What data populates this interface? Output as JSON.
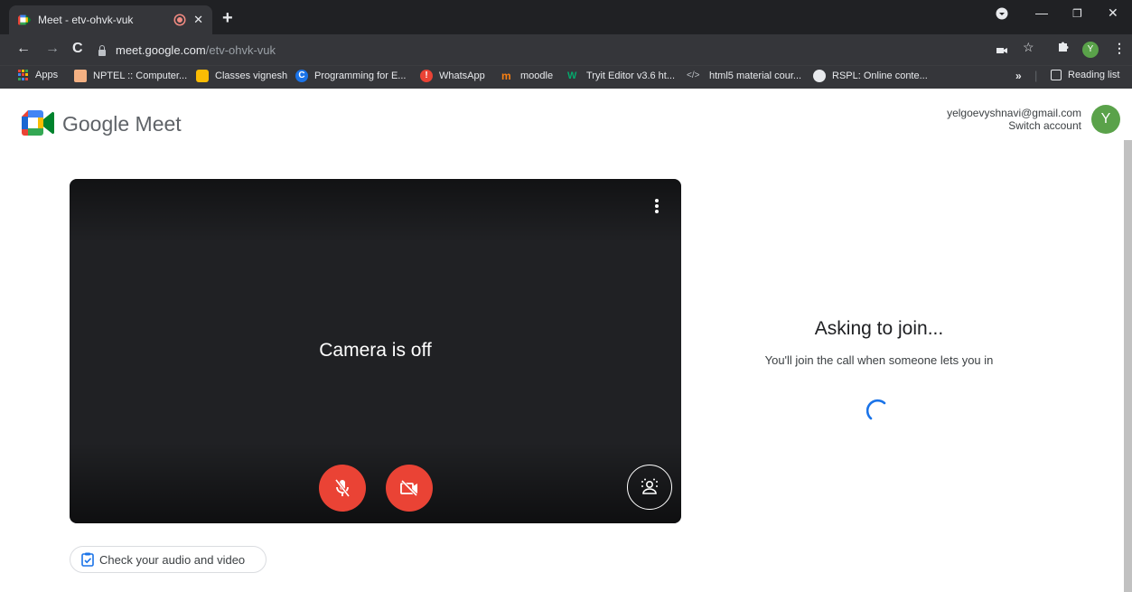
{
  "browser": {
    "tab": {
      "title": "Meet - etv-ohvk-vuk",
      "close_icon": "close-icon",
      "recording_indicator": "recording-dot-icon"
    },
    "new_tab": "+",
    "window_controls": {
      "minimize": "—",
      "restore": "❐",
      "close": "✕"
    },
    "url_host": "meet.google.com",
    "url_path": "/etv-ohvk-vuk",
    "profile_initial": "Y",
    "bookmarks": [
      {
        "label": "Apps",
        "icon": "apps-grid-icon"
      },
      {
        "label": "NPTEL :: Computer...",
        "icon": "nptel-icon"
      },
      {
        "label": "Classes vignesh",
        "icon": "classroom-icon"
      },
      {
        "label": "Programming for E...",
        "icon": "coursera-icon"
      },
      {
        "label": "WhatsApp",
        "icon": "whatsapp-icon"
      },
      {
        "label": "moodle",
        "icon": "moodle-icon"
      },
      {
        "label": "Tryit Editor v3.6 ht...",
        "icon": "w3schools-icon"
      },
      {
        "label": "html5 material cour...",
        "icon": "code-icon"
      },
      {
        "label": "RSPL: Online conte...",
        "icon": "globe-icon"
      }
    ],
    "overflow": "»",
    "reading_list": "Reading list"
  },
  "meet": {
    "brand": "Google Meet",
    "account_email": "yelgoevyshnavi@gmail.com",
    "switch_account": "Switch account",
    "avatar_initial": "Y",
    "preview": {
      "camera_status": "Camera is off",
      "mic_button": "mic-off-icon",
      "camera_button": "camera-off-icon",
      "effects_button": "visual-effects-icon",
      "more_options": "more-vert-icon"
    },
    "check_av_label": "Check your audio and video",
    "status": {
      "title": "Asking to join...",
      "description": "You'll join the call when someone lets you in"
    }
  },
  "colors": {
    "brand_green": "#5aa24a",
    "control_red": "#ea4335",
    "spinner_blue": "#1a73e8",
    "chrome_dark": "#202124"
  }
}
